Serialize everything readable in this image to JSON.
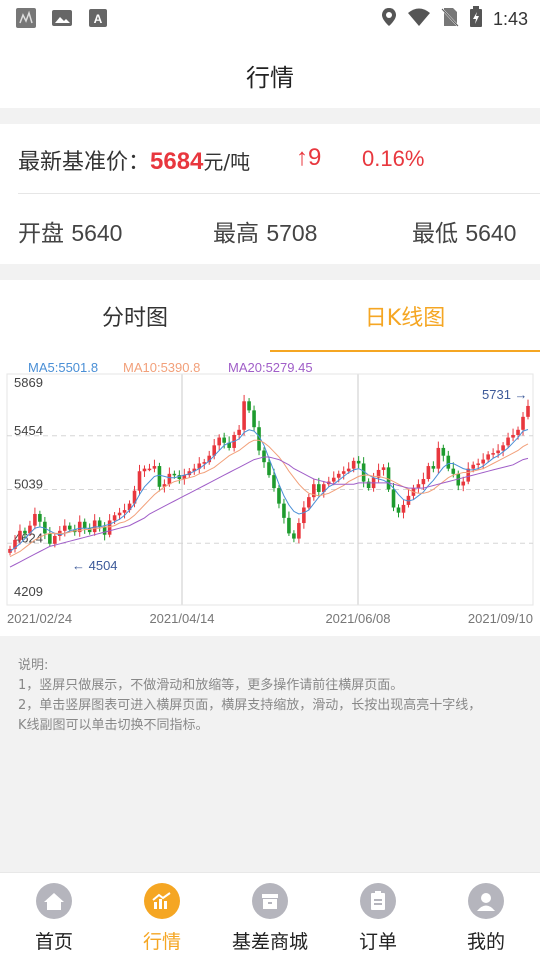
{
  "status_bar": {
    "time": "1:43",
    "icons": [
      "signal-box-icon",
      "image-icon",
      "font-a-icon",
      "location-icon",
      "wifi-icon",
      "no-sim-icon",
      "battery-charging-icon"
    ]
  },
  "header": {
    "title": "行情"
  },
  "price": {
    "label": "最新基准价：",
    "value": "5684",
    "unit": "元/吨",
    "change": "↑9",
    "change_pct": "0.16%",
    "open_label": "开盘",
    "open": "5640",
    "high_label": "最高",
    "high": "5708",
    "low_label": "最低",
    "low": "5640"
  },
  "tabs": [
    {
      "label": "分时图",
      "active": false
    },
    {
      "label": "日K线图",
      "active": true
    }
  ],
  "ma": {
    "ma5": "MA5:5501.8",
    "ma10": "MA10:5390.8",
    "ma20": "MA20:5279.45"
  },
  "colors": {
    "accent": "#f5a623",
    "up": "#e8373e",
    "down": "#1e9b2e",
    "ma5": "#4a8fd6",
    "ma10": "#f2a07a",
    "ma20": "#a05ec8"
  },
  "chart_data": {
    "type": "candlestick",
    "y_ticks": [
      "5869",
      "5454",
      "5039",
      "4624",
      "4209"
    ],
    "ylim": [
      4209,
      5869
    ],
    "x_ticks": [
      "2021/02/24",
      "2021/04/14",
      "2021/06/08",
      "2021/09/10"
    ],
    "max_marker": "5731",
    "min_marker": "4504",
    "closes": [
      4580,
      4650,
      4720,
      4700,
      4760,
      4850,
      4790,
      4700,
      4620,
      4680,
      4720,
      4760,
      4730,
      4710,
      4790,
      4740,
      4710,
      4800,
      4750,
      4690,
      4800,
      4840,
      4860,
      4880,
      4930,
      5030,
      5180,
      5200,
      5200,
      5220,
      5060,
      5080,
      5160,
      5150,
      5120,
      5150,
      5180,
      5200,
      5240,
      5250,
      5300,
      5380,
      5440,
      5400,
      5360,
      5460,
      5500,
      5720,
      5650,
      5520,
      5340,
      5250,
      5150,
      5050,
      4930,
      4820,
      4700,
      4660,
      4780,
      4900,
      4980,
      5080,
      5020,
      5080,
      5100,
      5130,
      5160,
      5180,
      5200,
      5260,
      5240,
      5100,
      5050,
      5130,
      5190,
      5210,
      5040,
      4900,
      4860,
      4920,
      4990,
      5050,
      5080,
      5120,
      5220,
      5200,
      5360,
      5300,
      5200,
      5160,
      5070,
      5100,
      5200,
      5230,
      5240,
      5270,
      5310,
      5320,
      5340,
      5380,
      5440,
      5460,
      5500,
      5600,
      5684
    ],
    "ma5": [
      4560,
      4590,
      4620,
      4660,
      4700,
      4740,
      4750,
      4740,
      4720,
      4700,
      4690,
      4700,
      4720,
      4730,
      4740,
      4740,
      4740,
      4750,
      4750,
      4760,
      4770,
      4790,
      4810,
      4840,
      4880,
      4930,
      5000,
      5060,
      5100,
      5140,
      5150,
      5140,
      5130,
      5130,
      5140,
      5150,
      5160,
      5180,
      5200,
      5230,
      5260,
      5300,
      5340,
      5380,
      5400,
      5410,
      5430,
      5480,
      5500,
      5490,
      5450,
      5380,
      5280,
      5180,
      5080,
      4990,
      4920,
      4870,
      4850,
      4860,
      4880,
      4930,
      4980,
      5020,
      5060,
      5080,
      5110,
      5140,
      5170,
      5190,
      5200,
      5180,
      5150,
      5130,
      5120,
      5110,
      5090,
      5050,
      5000,
      4960,
      4950,
      4960,
      4990,
      5020,
      5070,
      5110,
      5160,
      5210,
      5240,
      5240,
      5220,
      5200,
      5190,
      5190,
      5200,
      5220,
      5250,
      5280,
      5300,
      5330,
      5360,
      5400,
      5440,
      5490,
      5502
    ],
    "ma10": [
      4520,
      4540,
      4560,
      4590,
      4620,
      4650,
      4670,
      4690,
      4700,
      4700,
      4700,
      4700,
      4710,
      4720,
      4720,
      4730,
      4730,
      4740,
      4740,
      4750,
      4750,
      4760,
      4780,
      4790,
      4810,
      4840,
      4880,
      4920,
      4960,
      5000,
      5030,
      5060,
      5080,
      5100,
      5110,
      5120,
      5130,
      5140,
      5160,
      5170,
      5190,
      5210,
      5240,
      5270,
      5300,
      5320,
      5340,
      5370,
      5400,
      5420,
      5420,
      5400,
      5370,
      5330,
      5290,
      5240,
      5180,
      5130,
      5080,
      5040,
      5010,
      5000,
      4990,
      5000,
      5010,
      5030,
      5050,
      5070,
      5100,
      5120,
      5140,
      5150,
      5150,
      5140,
      5140,
      5130,
      5120,
      5100,
      5080,
      5060,
      5040,
      5020,
      5010,
      5010,
      5020,
      5040,
      5070,
      5100,
      5130,
      5150,
      5160,
      5170,
      5170,
      5180,
      5190,
      5200,
      5220,
      5240,
      5260,
      5280,
      5300,
      5320,
      5340,
      5370,
      5391
    ],
    "ma20": [
      4440,
      4460,
      4480,
      4500,
      4520,
      4540,
      4560,
      4580,
      4600,
      4610,
      4620,
      4630,
      4640,
      4650,
      4660,
      4670,
      4680,
      4690,
      4700,
      4710,
      4720,
      4730,
      4740,
      4750,
      4760,
      4780,
      4800,
      4820,
      4850,
      4870,
      4890,
      4910,
      4930,
      4950,
      4970,
      4990,
      5010,
      5030,
      5050,
      5070,
      5090,
      5110,
      5130,
      5150,
      5170,
      5190,
      5210,
      5230,
      5250,
      5270,
      5280,
      5290,
      5290,
      5280,
      5270,
      5250,
      5230,
      5200,
      5180,
      5160,
      5140,
      5120,
      5110,
      5100,
      5090,
      5080,
      5080,
      5080,
      5080,
      5080,
      5090,
      5090,
      5090,
      5090,
      5090,
      5090,
      5090,
      5080,
      5070,
      5060,
      5050,
      5050,
      5050,
      5050,
      5060,
      5070,
      5080,
      5090,
      5100,
      5110,
      5120,
      5130,
      5140,
      5150,
      5160,
      5170,
      5180,
      5190,
      5200,
      5210,
      5220,
      5230,
      5250,
      5270,
      5279
    ]
  },
  "notes": {
    "title": "说明:",
    "line1": "1，竖屏只做展示，不做滑动和放缩等，更多操作请前往横屏页面。",
    "line2": " 2，单击竖屏图表可进入横屏页面，横屏支持缩放，滑动，长按出现高亮十字线，",
    "line3": "K线副图可以单击切换不同指标。"
  },
  "nav": [
    {
      "label": "首页",
      "icon": "home-icon",
      "active": false
    },
    {
      "label": "行情",
      "icon": "chart-icon",
      "active": true
    },
    {
      "label": "基差商城",
      "icon": "store-icon",
      "active": false
    },
    {
      "label": "订单",
      "icon": "order-icon",
      "active": false
    },
    {
      "label": "我的",
      "icon": "user-icon",
      "active": false
    }
  ]
}
